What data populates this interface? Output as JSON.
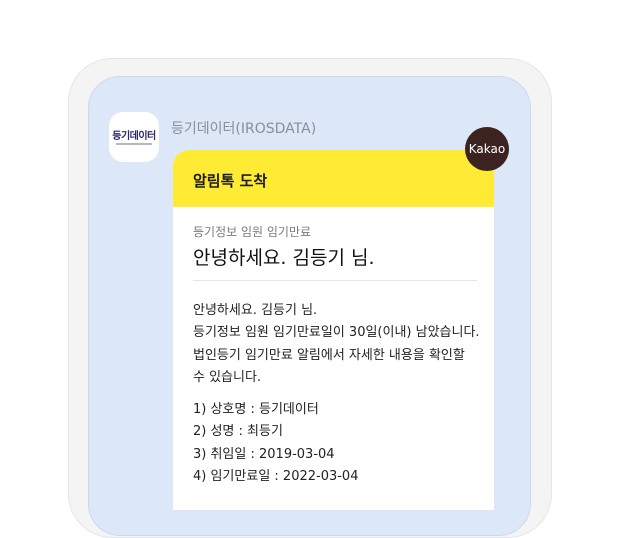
{
  "sender": {
    "logo_text": "등기데이터",
    "name": "등기데이터(IROSDATA)"
  },
  "badge": {
    "label": "Kakao",
    "color": "#3b2320"
  },
  "message": {
    "header_title": "알림톡 도착",
    "header_color": "#ffeb33",
    "subtitle": "등기정보 임원 임기만료",
    "title": "안녕하세요. 김등기 님.",
    "body": [
      "안녕하세요. 김등기 님.",
      "등기정보 임원 임기만료일이 30일(이내) 남았습니다.",
      "법인등기 임기만료 알림에서 자세한 내용을 확인할",
      "수 있습니다."
    ],
    "details": [
      "1) 상호명 : 등기데이터",
      "2) 성명 : 최등기",
      "3) 취임일 : 2019-03-04",
      "4) 임기만료일 : 2022-03-04"
    ]
  }
}
